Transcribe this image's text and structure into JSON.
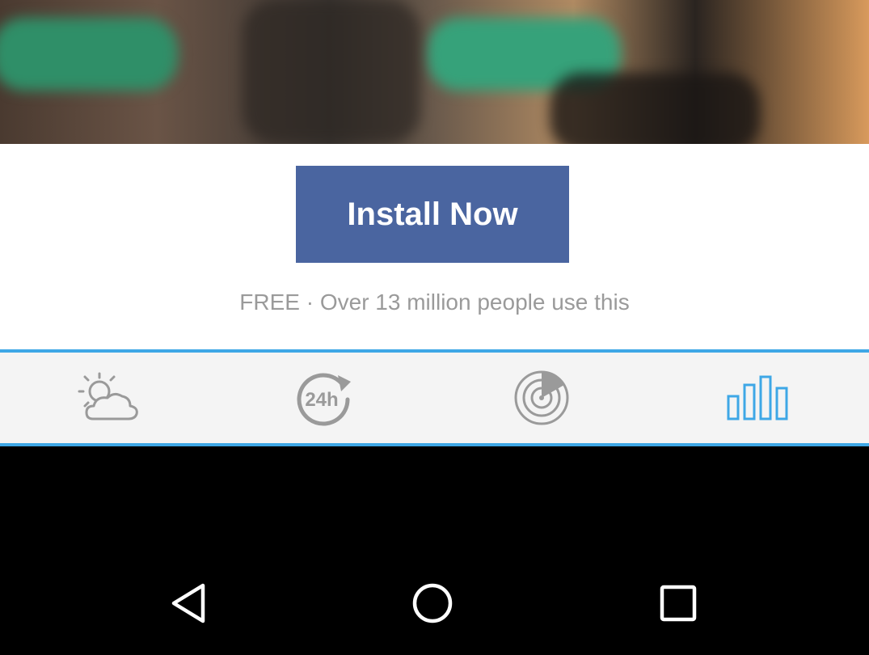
{
  "ad": {
    "install_label": "Install Now",
    "subtext": "FREE · Over 13 million people use this"
  },
  "tabs": [
    {
      "name": "forecast",
      "icon": "partly-cloudy-icon",
      "active": false
    },
    {
      "name": "hourly",
      "icon": "24h-refresh-icon",
      "active": false
    },
    {
      "name": "radar",
      "icon": "radar-icon",
      "active": false
    },
    {
      "name": "graphs",
      "icon": "bar-graph-icon",
      "active": true
    }
  ],
  "colors": {
    "install_button": "#4a65a0",
    "tab_accent": "#3ea7e6",
    "icon_inactive": "#9a9a9a",
    "icon_active": "#3ea7e6"
  },
  "nav": [
    {
      "icon": "back-icon"
    },
    {
      "icon": "home-icon"
    },
    {
      "icon": "recents-icon"
    }
  ]
}
